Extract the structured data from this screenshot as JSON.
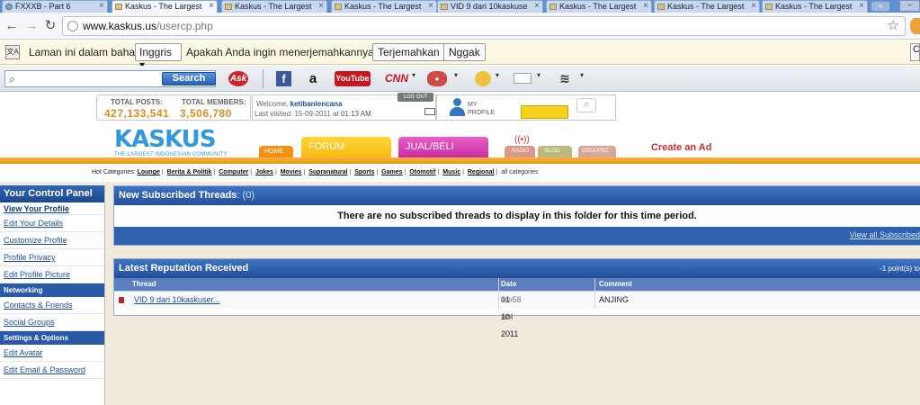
{
  "browser": {
    "tabs": [
      {
        "label": "FXXXB - Part 6",
        "icon": "globe-favicon"
      },
      {
        "label": "Kaskus - The Largest",
        "icon": "kaskus-favicon",
        "active": true
      },
      {
        "label": "Kaskus - The Largest",
        "icon": "kaskus-favicon"
      },
      {
        "label": "Kaskus - The Largest",
        "icon": "kaskus-favicon"
      },
      {
        "label": "VID 9 dari 10kaskuse",
        "icon": "kaskus-favicon"
      },
      {
        "label": "Kaskus - The Largest",
        "icon": "kaskus-favicon"
      },
      {
        "label": "Kaskus - The Largest",
        "icon": "kaskus-favicon"
      },
      {
        "label": "Kaskus - The Largest",
        "icon": "kaskus-favicon"
      }
    ],
    "url_host": "www.kaskus.us",
    "url_path": "/usercp.php"
  },
  "translate_bar": {
    "message": "Laman ini dalam bahasa",
    "language": "Inggris",
    "question": "Apakah Anda ingin menerjemahkannya?",
    "translate_button": "Terjemahkan",
    "no_button": "Nggak"
  },
  "toolbar": {
    "search_button": "Search",
    "search_placeholder": "",
    "ask_label": "Ask",
    "youtube_label": "YouTube",
    "cnn_label": "CNN"
  },
  "header": {
    "total_posts_label": "TOTAL POSTS:",
    "total_posts": "427,133,541",
    "total_members_label": "TOTAL MEMBERS:",
    "total_members": "3,506,780",
    "welcome_prefix": "Welcome,",
    "username": "ketibanlencana",
    "last_visited_label": "Last visited:",
    "last_visited_date": "15-09-2011",
    "last_visited_at": "at",
    "last_visited_time": "01:13 AM",
    "logout_label": "LOG OUT",
    "my_profile_label": "MY PROFILE"
  },
  "site_nav": {
    "logo_text": "KASKUS",
    "tagline": "THE LARGEST INDONESIAN COMMUNITY",
    "home": "HOME",
    "forum": "FORUM",
    "jual_beli": "JUAL/BELI",
    "radio": "RADIO",
    "blog": "BLOG",
    "groupee": "GROUPEE",
    "create_ad": "Create an Ad"
  },
  "hot_categories": {
    "label": "Hot Categories:",
    "items": [
      "Lounge",
      "Berita & Politik",
      "Computer",
      "Jokes",
      "Movies",
      "Supranatural",
      "Sports",
      "Games",
      "Otomotif",
      "Music",
      "Regional"
    ],
    "all": "all categories"
  },
  "sidebar": {
    "title": "Your Control Panel",
    "profile_links": [
      "View Your Profile",
      "Edit Your Details",
      "Customize Profile",
      "Profile Privacy",
      "Edit Profile Picture"
    ],
    "networking_head": "Networking",
    "networking_links": [
      "Contacts & Friends",
      "Social Groups"
    ],
    "settings_head": "Settings & Options",
    "settings_links": [
      "Edit Avatar",
      "Edit Email & Password"
    ]
  },
  "subscribed": {
    "title": "New Subscribed Threads",
    "count": ": (0)",
    "empty_message": "There are no subscribed threads to display in this folder for this time period.",
    "view_all": "View all Subscribed"
  },
  "reputation": {
    "title": "Latest Reputation Received",
    "right_text": "-1 point(s) to",
    "columns": [
      "Thread",
      "Date",
      "Comment"
    ],
    "rows": [
      {
        "thread": "VID 9 dari 10kaskuser...",
        "date": "01-10-2011",
        "time": "10:58 AM",
        "comment": "ANJING"
      }
    ]
  },
  "colors": {
    "accent_blue": "#234f98",
    "kaskus_orange": "#e89616",
    "link_blue": "#1c4e9a"
  }
}
